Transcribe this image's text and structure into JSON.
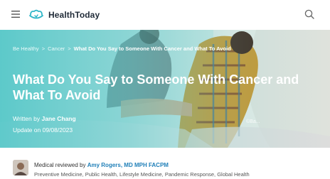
{
  "header": {
    "brand": "HealthToday",
    "menu_icon": "hamburger-menu-icon",
    "search_icon": "search-icon",
    "brand_color": "#2fb6c8"
  },
  "hero": {
    "breadcrumb": [
      "Be Healthy",
      "Cancer",
      "What Do You Say to Someone With Cancer and What To Avoid"
    ],
    "breadcrumb_separator": ">",
    "title": "What Do You Say to Someone With Cancer and What To Avoid",
    "written_by_label": "Written by",
    "author": "Jane Chang",
    "update_text": "Update on 09/08/2023",
    "caption": "©Ba...",
    "overlay_color": "#40c2c4"
  },
  "review": {
    "label": "Medical reviewed by",
    "reviewer": "Amy Rogers, MD MPH FACPM",
    "specialties": "Preventive Medicine, Public Health, Lifestyle Medicine, Pandemic Response, Global Health",
    "link_color": "#1f7fb8"
  }
}
